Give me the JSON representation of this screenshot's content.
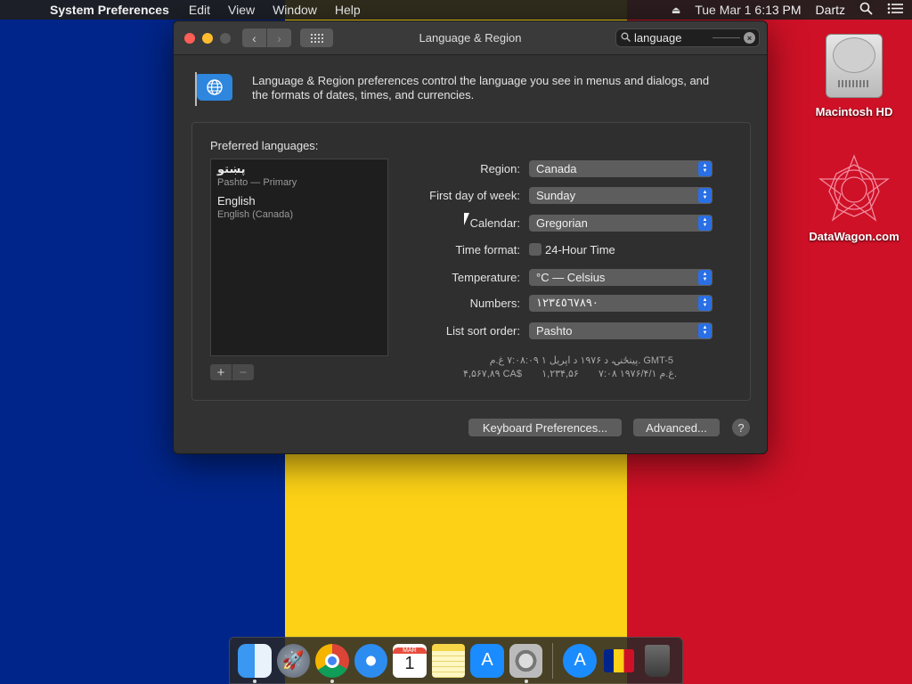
{
  "menubar": {
    "app_name": "System Preferences",
    "menus": [
      "Edit",
      "View",
      "Window",
      "Help"
    ],
    "datetime": "Tue Mar 1  6:13 PM",
    "user": "Dartz"
  },
  "window": {
    "title": "Language & Region",
    "search": {
      "value": "language"
    },
    "intro": "Language & Region preferences control the language you see in menus and dialogs, and the formats of dates, times, and currencies.",
    "preferred_label": "Preferred languages:",
    "languages": [
      {
        "name": "پښتو",
        "sub": "Pashto — Primary"
      },
      {
        "name": "English",
        "sub": "English (Canada)"
      }
    ],
    "settings": {
      "region": {
        "label": "Region:",
        "value": "Canada"
      },
      "first_day": {
        "label": "First day of week:",
        "value": "Sunday"
      },
      "calendar": {
        "label": "Calendar:",
        "value": "Gregorian"
      },
      "time_format": {
        "label": "Time format:",
        "checkbox_label": "24-Hour Time",
        "checked": false
      },
      "temperature": {
        "label": "Temperature:",
        "value": "°C — Celsius"
      },
      "numbers": {
        "label": "Numbers:",
        "value": "١٢٣٤٥٦٧٨٩٠"
      },
      "sort_order": {
        "label": "List sort order:",
        "value": "Pashto"
      }
    },
    "sample": {
      "line1": "پينځنۍ، د ۱۹۷۶ د اپریل ۱ ۷:۰۸:۰۹ غ.م. GMT-5",
      "line2_date": "۷:۰۸ ۱۹۷۶/۴/۱ غ.م.",
      "line2_number": "۱,۲۳۴,۵۶",
      "line2_currency": "۴,۵۶۷,۸۹ CA$"
    },
    "buttons": {
      "keyboard": "Keyboard Preferences...",
      "advanced": "Advanced...",
      "help": "?"
    }
  },
  "desktop": {
    "icons": [
      {
        "label": "Macintosh HD"
      },
      {
        "label": "DataWagon.com"
      }
    ]
  },
  "dock": {
    "calendar_month": "MAR",
    "calendar_day": "1"
  }
}
